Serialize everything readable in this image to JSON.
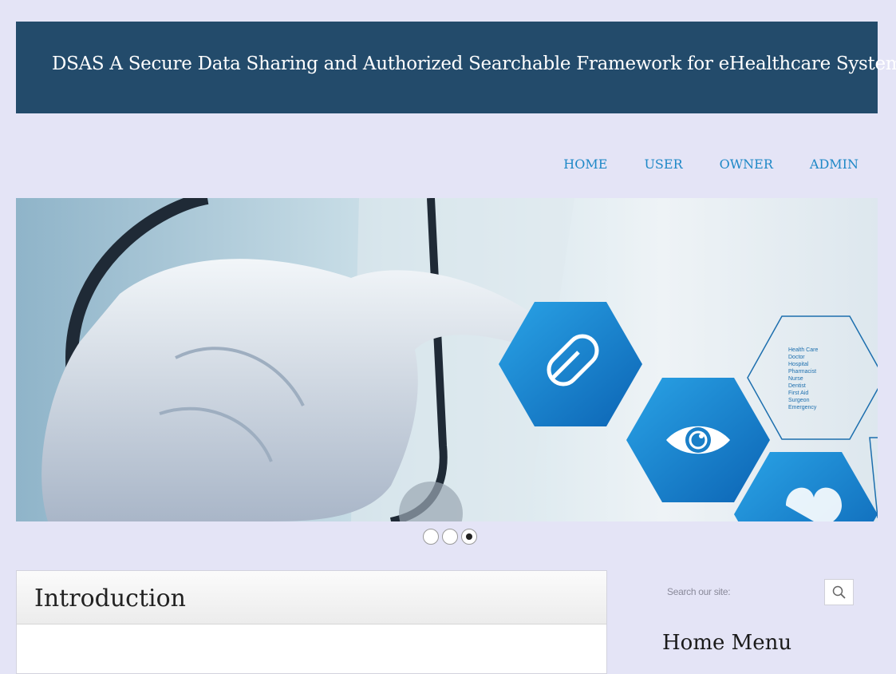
{
  "header": {
    "title": "DSAS A Secure Data Sharing and Authorized Searchable Framework for eHealthcare System"
  },
  "nav": {
    "items": [
      {
        "label": "HOME"
      },
      {
        "label": "USER"
      },
      {
        "label": "OWNER"
      },
      {
        "label": "ADMIN"
      }
    ]
  },
  "banner": {
    "hex_list": [
      "Health Care",
      "Doctor",
      "Hospital",
      "Pharmacist",
      "Nurse",
      "Dentist",
      "First Aid",
      "Surgeon",
      "Emergency"
    ],
    "icons": [
      "pill-icon",
      "eye-icon",
      "heart-icon"
    ]
  },
  "slider": {
    "count": 3,
    "active_index": 3
  },
  "main": {
    "intro_title": "Introduction"
  },
  "sidebar": {
    "search_placeholder": "Search our site:",
    "menu_title": "Home Menu"
  },
  "colors": {
    "header_bg": "#234b6b",
    "page_bg": "#e4e4f6",
    "nav_link": "#1e88c7",
    "hex_blue": "#1a7fc8"
  }
}
